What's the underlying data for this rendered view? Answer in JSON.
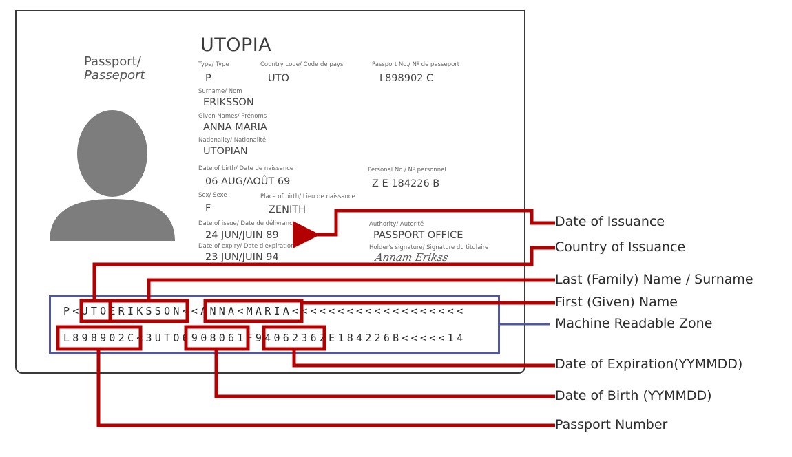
{
  "passport": {
    "doc_type_title": "Passport/",
    "doc_type_title_fr": "Passeport",
    "country_name": "UTOPIA",
    "fields": {
      "type": {
        "label": "Type/ Type",
        "value": "P"
      },
      "country_code": {
        "label": "Country code/ Code de pays",
        "value": "UTO"
      },
      "passport_no": {
        "label": "Passport No./ Nº de passeport",
        "value": "L898902 C"
      },
      "surname": {
        "label": "Surname/ Nom",
        "value": "ERIKSSON"
      },
      "given_names": {
        "label": "Given Names/ Prénoms",
        "value": "ANNA MARIA"
      },
      "nationality": {
        "label": "Nationality/ Nationalité",
        "value": "UTOPIAN"
      },
      "date_of_birth": {
        "label": "Date of birth/ Date de naissance",
        "value": "06 AUG/AOÛT 69"
      },
      "personal_no": {
        "label": "Personal No./ Nº personnel",
        "value": "Z E 184226 B"
      },
      "sex": {
        "label": "Sex/ Sexe",
        "value": "F"
      },
      "place_of_birth": {
        "label": "Place of birth/ Lieu de naissance",
        "value": "ZENITH"
      },
      "date_of_issue": {
        "label": "Date of issue/ Date de délivrance",
        "value": "24 JUN/JUIN 89"
      },
      "authority": {
        "label": "Authority/ Autorité",
        "value": "PASSPORT OFFICE"
      },
      "date_of_expiry": {
        "label": "Date of expiry/ Date d'expiration",
        "value": "23 JUN/JUIN 94"
      },
      "signature": {
        "label": "Holder's signature/ Signature du titulaire",
        "value": "Annam Erikss"
      }
    },
    "mrz": {
      "line1": "P<UTOERIKSSON<<ANNA<MARIA<<<<<<<<<<<<<<<<<<<",
      "line2": "L898902C<3UTO6908061F9406236ZE184226B<<<<<14"
    },
    "photo_placeholder": "person-silhouette-icon"
  },
  "callouts": [
    {
      "id": "date-of-issuance",
      "label": "Date of Issuance"
    },
    {
      "id": "country-of-issuance",
      "label": "Country of Issuance"
    },
    {
      "id": "surname",
      "label": "Last (Family) Name / Surname"
    },
    {
      "id": "given-name",
      "label": "First (Given) Name"
    },
    {
      "id": "mrz",
      "label": "Machine Readable Zone"
    },
    {
      "id": "date-of-expiration",
      "label": "Date of Expiration(YYMMDD)"
    },
    {
      "id": "date-of-birth",
      "label": "Date of Birth (YYMMDD)"
    },
    {
      "id": "passport-number",
      "label": "Passport Number"
    }
  ],
  "colors": {
    "highlight_red": "#b30000",
    "mrz_blue": "#5156a2",
    "border_dark": "#3a3a3a",
    "silhouette_gray": "#7d7d7d"
  }
}
